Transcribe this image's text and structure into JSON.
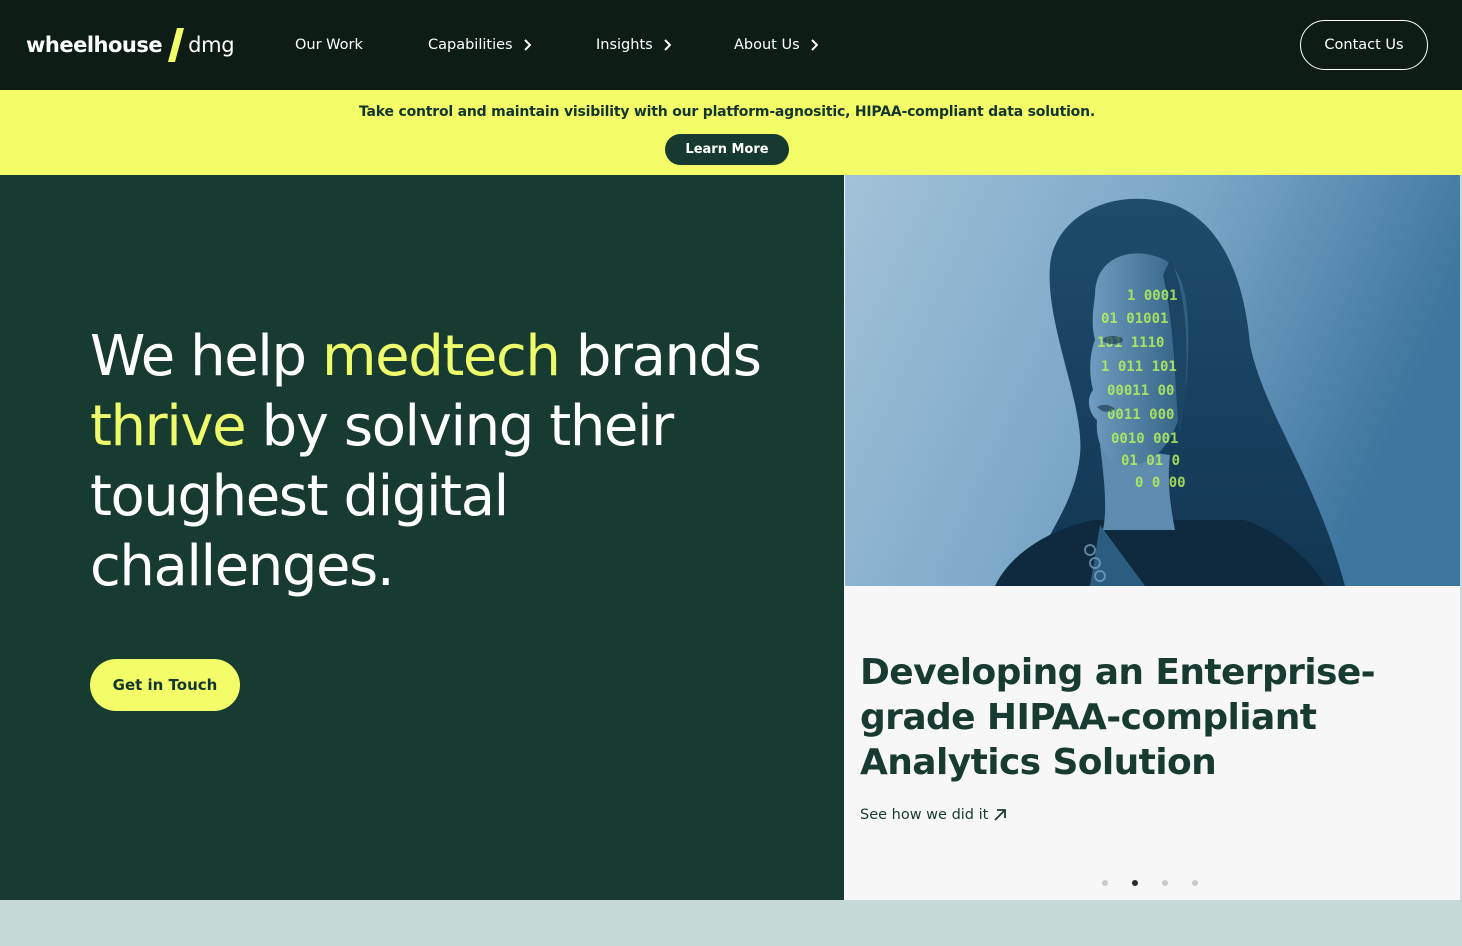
{
  "brand": {
    "logo_main": "wheelhouse",
    "logo_sub": "dmg"
  },
  "nav": {
    "items": [
      {
        "label": "Our Work"
      },
      {
        "label": "Capabilities"
      },
      {
        "label": "Insights"
      },
      {
        "label": "About Us"
      }
    ],
    "contact_label": "Contact Us"
  },
  "banner": {
    "text": "Take control and maintain visibility with our platform-agnositic, HIPAA-compliant data solution.",
    "button_label": "Learn More"
  },
  "hero": {
    "headline": {
      "part1": "We help ",
      "highlight1": "medtech",
      "part2": " brands ",
      "highlight2": "thrive",
      "part3": " by solving their toughest digital challenges."
    },
    "cta_label": "Get in Touch"
  },
  "feature_card": {
    "title": "Developing an Enterprise-grade HIPAA-compliant Analytics Solution",
    "link_label": "See how we did it",
    "slides_total": 4,
    "active_slide": 2
  },
  "colors": {
    "nav_bg": "#0e1c16",
    "banner_bg": "#f3fd68",
    "hero_bg": "#183b31",
    "accent": "#eefb6a",
    "card_bg": "#f7f7f7",
    "footer_strip": "#c7d9d7"
  },
  "icons": {
    "chevron": "chevron-right-icon",
    "arrow": "arrow-up-right-icon",
    "slash": "logo-slash-icon"
  }
}
